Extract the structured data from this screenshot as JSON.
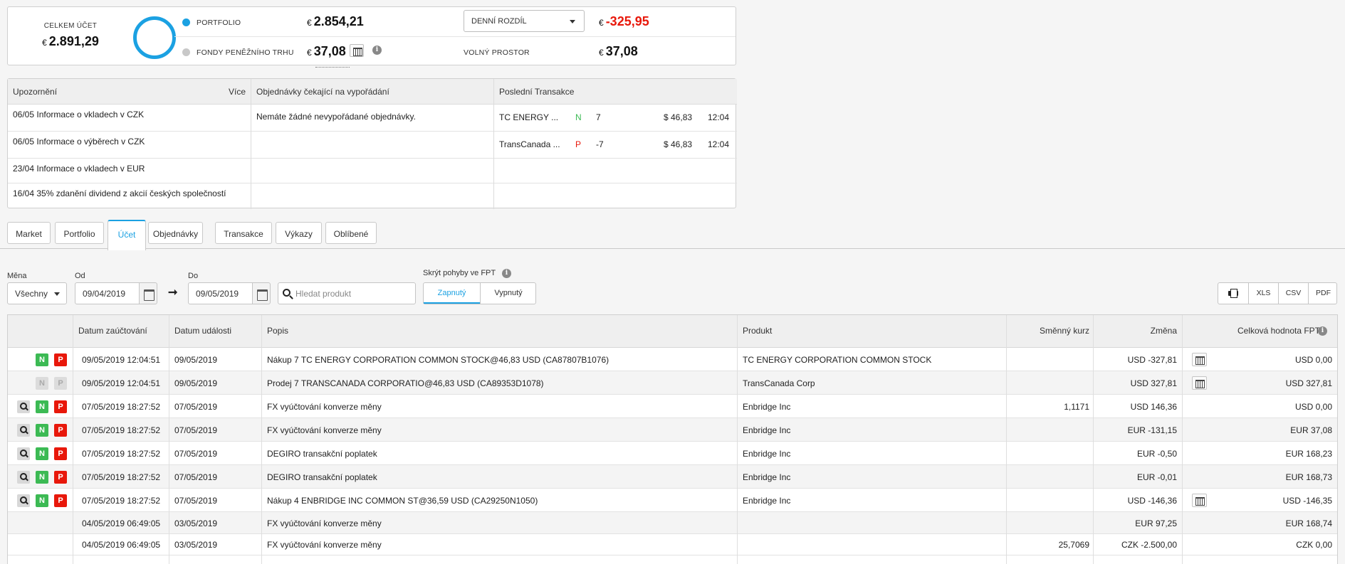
{
  "summary": {
    "total_label": "CELKEM ÚČET",
    "currency_symbol": "€",
    "total_value": "2.891,29",
    "portfolio_label": "PORTFOLIO",
    "portfolio_value": "2.854,21",
    "funds_label": "FONDY PENĚŽNÍHO TRHU",
    "funds_value": "37,08",
    "daily_diff_select": "DENNÍ ROZDÍL",
    "daily_diff_value": "-325,95",
    "free_space_label": "VOLNÝ PROSTOR",
    "free_space_value": "37,08",
    "colors": {
      "portfolio": "#1ba1e2",
      "funds": "#c8c8c8",
      "negative": "#e8180b"
    }
  },
  "notices": {
    "header": "Upozornění",
    "more": "Více",
    "items": [
      "06/05 Informace o vkladech v CZK",
      "06/05 Informace o výběrech v CZK",
      "23/04 Informace o vkladech v EUR",
      "16/04 35% zdanění dividend z akcií českých společností"
    ]
  },
  "pending": {
    "header": "Objednávky čekající na vypořádání",
    "empty": "Nemáte žádné nevypořádané objednávky."
  },
  "recent": {
    "header": "Poslední Transakce",
    "rows": [
      {
        "product": "TC ENERGY ...",
        "side": "N",
        "qty": "7",
        "price": "$ 46,83",
        "time": "12:04"
      },
      {
        "product": "TransCanada ...",
        "side": "P",
        "qty": "-7",
        "price": "$ 46,83",
        "time": "12:04"
      }
    ]
  },
  "tabs": [
    "Market",
    "Portfolio",
    "Účet",
    "Objednávky",
    "Transakce",
    "Výkazy",
    "Oblíbené"
  ],
  "active_tab": "Účet",
  "filters": {
    "currency_label": "Měna",
    "currency_value": "Všechny",
    "from_label": "Od",
    "from_value": "09/04/2019",
    "to_label": "Do",
    "to_value": "09/05/2019",
    "search_placeholder": "Hledat produkt",
    "hide_fpt_label": "Skrýt pohyby ve FPT",
    "toggle_on": "Zapnutý",
    "toggle_off": "Vypnutý",
    "exports": [
      "XLS",
      "CSV",
      "PDF"
    ]
  },
  "table": {
    "columns": [
      "Datum zaúčtování",
      "Datum události",
      "Popis",
      "Produkt",
      "Směnný kurz",
      "Změna",
      "Celková hodnota FPT"
    ],
    "rows": [
      {
        "actions": "np",
        "booked": "09/05/2019 12:04:51",
        "event": "09/05/2019",
        "desc": "Nákup 7 TC ENERGY CORPORATION COMMON STOCK@46,83 USD (CA87807B1076)",
        "product": "TC ENERGY CORPORATION COMMON STOCK",
        "rate": "",
        "change": "USD -327,81",
        "cal": true,
        "fpt": "USD 0,00"
      },
      {
        "actions": "dis",
        "booked": "09/05/2019 12:04:51",
        "event": "09/05/2019",
        "desc": "Prodej 7 TRANSCANADA CORPORATIO@46,83 USD (CA89353D1078)",
        "product": "TransCanada Corp",
        "rate": "",
        "change": "USD 327,81",
        "cal": true,
        "fpt": "USD 327,81"
      },
      {
        "actions": "snp",
        "booked": "07/05/2019 18:27:52",
        "event": "07/05/2019",
        "desc": "FX vyúčtování konverze měny",
        "product": "Enbridge Inc",
        "rate": "1,1171",
        "change": "USD 146,36",
        "cal": false,
        "fpt": "USD 0,00"
      },
      {
        "actions": "snp",
        "booked": "07/05/2019 18:27:52",
        "event": "07/05/2019",
        "desc": "FX vyúčtování konverze měny",
        "product": "Enbridge Inc",
        "rate": "",
        "change": "EUR -131,15",
        "cal": false,
        "fpt": "EUR 37,08"
      },
      {
        "actions": "snp",
        "booked": "07/05/2019 18:27:52",
        "event": "07/05/2019",
        "desc": "DEGIRO transakční poplatek",
        "product": "Enbridge Inc",
        "rate": "",
        "change": "EUR -0,50",
        "cal": false,
        "fpt": "EUR 168,23"
      },
      {
        "actions": "snp",
        "booked": "07/05/2019 18:27:52",
        "event": "07/05/2019",
        "desc": "DEGIRO transakční poplatek",
        "product": "Enbridge Inc",
        "rate": "",
        "change": "EUR -0,01",
        "cal": false,
        "fpt": "EUR 168,73"
      },
      {
        "actions": "snp",
        "booked": "07/05/2019 18:27:52",
        "event": "07/05/2019",
        "desc": "Nákup 4 ENBRIDGE INC COMMON ST@36,59 USD (CA29250N1050)",
        "product": "Enbridge Inc",
        "rate": "",
        "change": "USD -146,36",
        "cal": true,
        "fpt": "USD -146,35"
      },
      {
        "actions": "",
        "booked": "04/05/2019 06:49:05",
        "event": "03/05/2019",
        "desc": "FX vyúčtování konverze měny",
        "product": "",
        "rate": "",
        "change": "EUR 97,25",
        "cal": false,
        "fpt": "EUR 168,74"
      },
      {
        "actions": "",
        "booked": "04/05/2019 06:49:05",
        "event": "03/05/2019",
        "desc": "FX vyúčtování konverze měny",
        "product": "",
        "rate": "25,7069",
        "change": "CZK -2.500,00",
        "cal": false,
        "fpt": "CZK 0,00"
      }
    ]
  }
}
